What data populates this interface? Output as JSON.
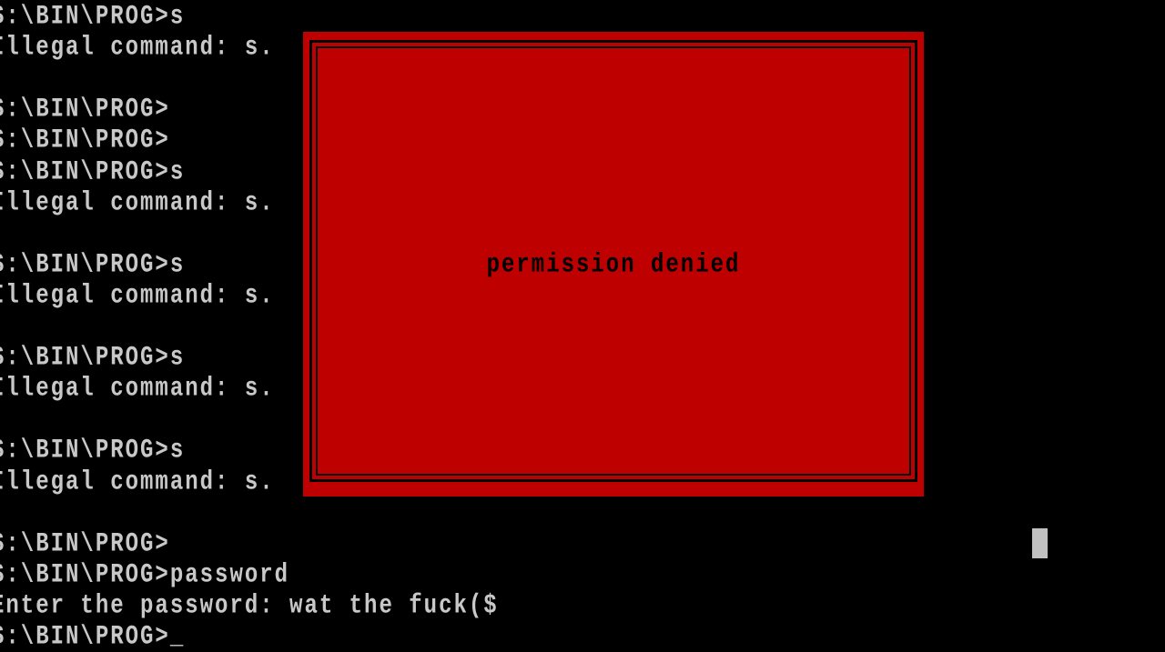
{
  "terminal": {
    "lines": [
      "S:\\BIN\\PROG>s",
      "Illegal command: s.",
      "",
      "S:\\BIN\\PROG>",
      "S:\\BIN\\PROG>",
      "S:\\BIN\\PROG>s",
      "Illegal command: s.",
      "",
      "S:\\BIN\\PROG>s",
      "Illegal command: s.",
      "",
      "S:\\BIN\\PROG>s",
      "Illegal command: s.",
      "",
      "S:\\BIN\\PROG>s",
      "Illegal command: s.",
      "",
      "S:\\BIN\\PROG>",
      "S:\\BIN\\PROG>password",
      "Enter the password: wat the fuck($",
      "S:\\BIN\\PROG>_"
    ]
  },
  "dialog": {
    "message": "permission denied"
  },
  "colors": {
    "background": "#000000",
    "text": "#c8c8c8",
    "dialog_bg": "#bf0000",
    "dialog_text": "#000000"
  }
}
